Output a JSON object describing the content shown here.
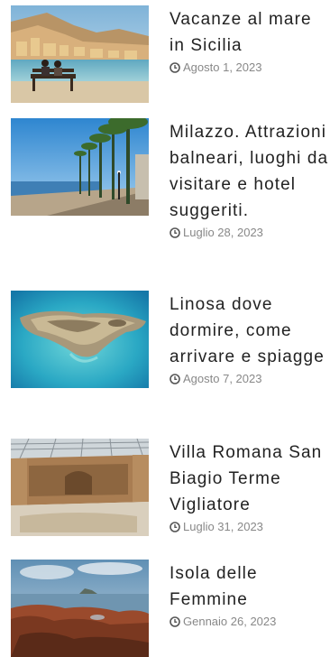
{
  "posts": [
    {
      "title": "Vacanze al mare in Sicilia",
      "date": "Agosto 1, 2023",
      "thumb_icon": "seaside-town-photo"
    },
    {
      "title": "Milazzo. Attrazioni balneari, luoghi da visitare e hotel suggeriti.",
      "date": "Luglio 28, 2023",
      "thumb_icon": "palm-promenade-photo"
    },
    {
      "title": "Linosa dove dormire, come arrivare e spiagge",
      "date": "Agosto 7, 2023",
      "thumb_icon": "island-aerial-photo"
    },
    {
      "title": "Villa Romana San Biagio Terme Vigliatore",
      "date": "Luglio 31, 2023",
      "thumb_icon": "roman-villa-photo"
    },
    {
      "title": "Isola delle Femmine",
      "date": "Gennaio 26, 2023",
      "thumb_icon": "rocky-coast-photo"
    }
  ],
  "colors": {
    "title": "#222222",
    "date": "#888888"
  }
}
